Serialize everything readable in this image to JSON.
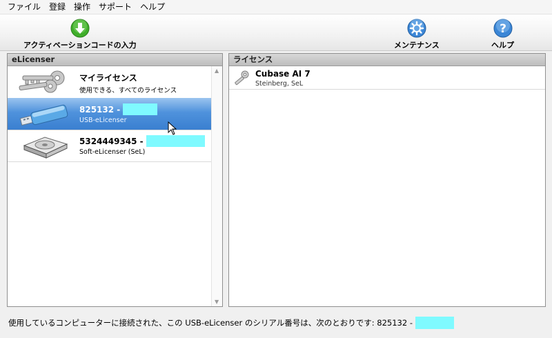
{
  "menu": [
    "ファイル",
    "登録",
    "操作",
    "サポート",
    "ヘルプ"
  ],
  "toolbar": {
    "activation_label": "アクティベーションコードの入力",
    "maintenance_label": "メンテナンス",
    "help_label": "ヘルプ"
  },
  "left_panel": {
    "header": "eLicenser",
    "items": [
      {
        "title": "マイライセンス",
        "subtitle": "使用できる、すべてのライセンス",
        "icon": "keys-icon"
      },
      {
        "title": "825132 -",
        "subtitle": "USB-eLicenser",
        "icon": "usb-stick-icon",
        "selected": true
      },
      {
        "title": "5324449345 -",
        "subtitle": "Soft-eLicenser (SeL)",
        "icon": "hard-drive-icon"
      }
    ]
  },
  "right_panel": {
    "header": "ライセンス",
    "items": [
      {
        "title": "Cubase AI 7",
        "subtitle": "Steinberg, SeL",
        "icon": "key-icon"
      }
    ]
  },
  "status": {
    "text": "使用しているコンピューターに接続された、この USB-eLicenser のシリアル番号は、次のとおりです: 825132 -"
  },
  "colors": {
    "selection": "#3a7fd0",
    "redaction": "#7ffaff",
    "activation_icon": "#3fae2a",
    "maintenance_icon": "#3b86d6"
  }
}
